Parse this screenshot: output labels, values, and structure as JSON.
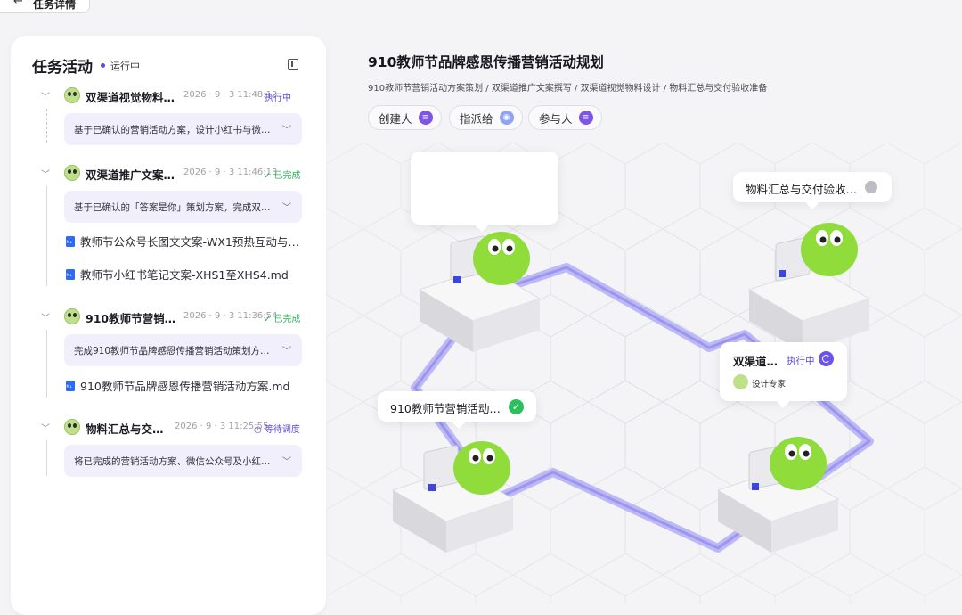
{
  "topbar": {
    "back_icon": "←",
    "title": "任务详情"
  },
  "panel": {
    "title": "任务活动",
    "status": "运行中",
    "tasks": [
      {
        "name": "双渠道视觉物料…",
        "time": "2026 · 9 · 3 11:48:12",
        "status": "执行中",
        "status_type": "running",
        "desc": "基于已确认的营销活动方案，设计小红书与微…",
        "files": []
      },
      {
        "name": "双渠道推广文案…",
        "time": "2026 · 9 · 3 11:46:13",
        "status": "✓ 已完成",
        "status_type": "done",
        "desc": "基于已确认的「答案是你」策划方案，完成双…",
        "files": [
          "教师节公众号长图文文案-WX1预热互动与…",
          "教师节小红书笔记文案-XHS1至XHS4.md"
        ]
      },
      {
        "name": "910教师节营销…",
        "time": "2026 · 9 · 3 11:36:54",
        "status": "✓ 已完成",
        "status_type": "done",
        "desc": "完成910教师节品牌感恩传播营销活动策划方…",
        "files": [
          "910教师节品牌感恩传播营销活动方案.md"
        ]
      },
      {
        "name": "物料汇总与交…",
        "time": "2026 · 9 · 3 11:25:55",
        "status": "◷ 等待调度",
        "status_type": "wait",
        "desc": "将已完成的营销活动方案、微信公众号及小红…",
        "files": []
      }
    ]
  },
  "main": {
    "title": "910教师节品牌感恩传播营销活动规划",
    "breadcrumb": "910教师节营销活动方案策划 / 双渠道推广文案撰写 / 双渠道视觉物料设计 / 物料汇总与交付验收准备",
    "chips": [
      {
        "label": "创建人",
        "icon": "user-avatar-icon"
      },
      {
        "label": "指派给",
        "icon": "robot-avatar-icon"
      },
      {
        "label": "参与人",
        "icon": "user-avatar-icon"
      }
    ]
  },
  "scene": {
    "bubble_material": "物料汇总与交付验收…",
    "bubble_plan": "910教师节营销活动…",
    "bubble_exec_name": "双渠道…",
    "bubble_exec_status": "执行中",
    "bubble_exec_role": "设计专家",
    "colors": {
      "path": "#9b96f0",
      "accent": "#5b4bd9",
      "done": "#2cb35a",
      "mascot": "#8fdc3a"
    }
  }
}
